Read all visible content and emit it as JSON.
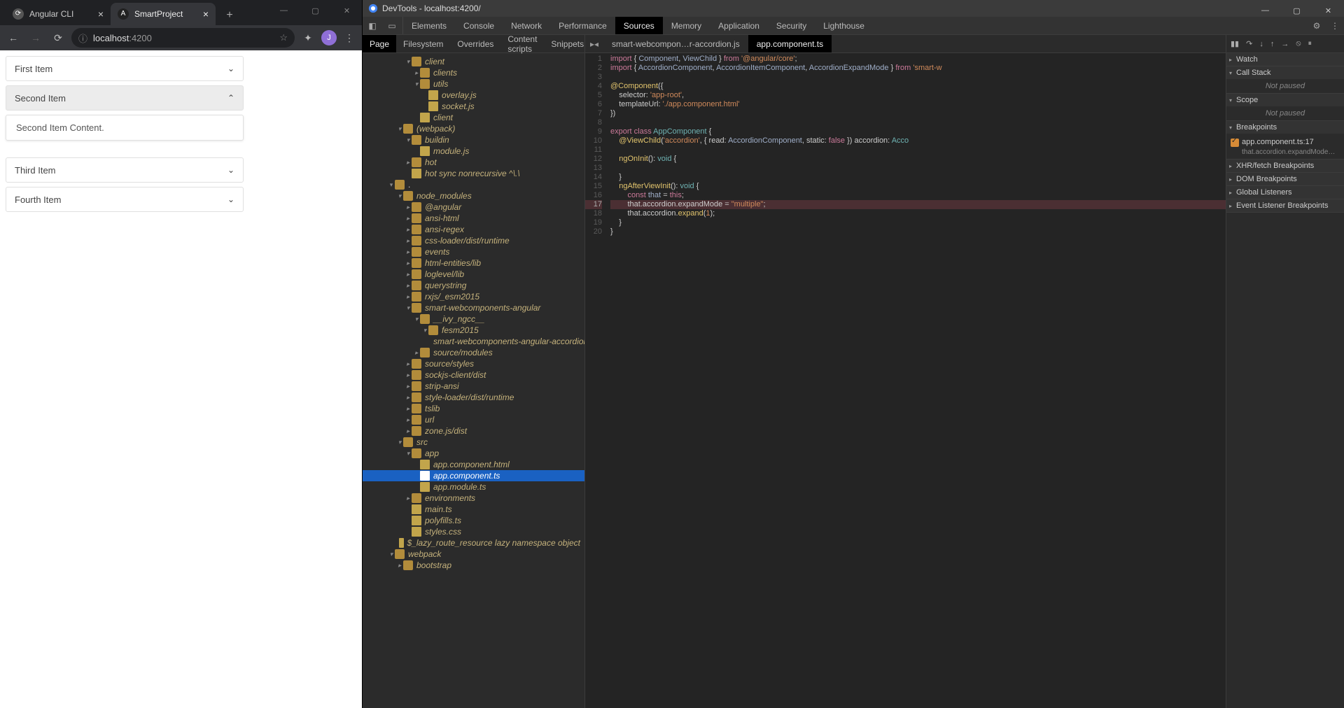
{
  "chrome": {
    "tabs": [
      {
        "label": "Angular CLI",
        "favicon": ""
      },
      {
        "label": "SmartProject",
        "favicon": "A"
      }
    ],
    "active_tab": 1,
    "url_prefix": "localhost",
    "url_suffix": ":4200",
    "avatar_letter": "J"
  },
  "accordion": [
    {
      "title": "First Item",
      "expanded": false,
      "content": ""
    },
    {
      "title": "Second Item",
      "expanded": true,
      "content": "Second Item Content."
    },
    {
      "title": "Third Item",
      "expanded": false,
      "content": ""
    },
    {
      "title": "Fourth Item",
      "expanded": false,
      "content": ""
    }
  ],
  "devtools": {
    "title": "DevTools - localhost:4200/",
    "main_tabs": [
      "Elements",
      "Console",
      "Network",
      "Performance",
      "Sources",
      "Memory",
      "Application",
      "Security",
      "Lighthouse"
    ],
    "active_main_tab": "Sources",
    "src_sub_tabs": [
      "Page",
      "Filesystem",
      "Overrides",
      "Content scripts",
      "Snippets"
    ],
    "active_src_sub": "Page",
    "editor_tabs": [
      "smart-webcompon…r-accordion.js",
      "app.component.ts"
    ],
    "active_editor_tab": 1,
    "tree": [
      {
        "d": 5,
        "a": "▾",
        "i": "folder-open",
        "t": "client",
        "it": true
      },
      {
        "d": 6,
        "a": "▸",
        "i": "folder",
        "t": "clients",
        "it": true
      },
      {
        "d": 6,
        "a": "▾",
        "i": "folder-open",
        "t": "utils",
        "it": true
      },
      {
        "d": 7,
        "a": "",
        "i": "file",
        "t": "overlay.js",
        "it": true
      },
      {
        "d": 7,
        "a": "",
        "i": "file",
        "t": "socket.js",
        "it": true
      },
      {
        "d": 6,
        "a": "",
        "i": "file",
        "t": "client",
        "it": true
      },
      {
        "d": 4,
        "a": "▾",
        "i": "folder-open",
        "t": "(webpack)",
        "it": true
      },
      {
        "d": 5,
        "a": "▾",
        "i": "folder-open",
        "t": "buildin",
        "it": true
      },
      {
        "d": 6,
        "a": "",
        "i": "file",
        "t": "module.js",
        "it": true
      },
      {
        "d": 5,
        "a": "▸",
        "i": "folder",
        "t": "hot",
        "it": true
      },
      {
        "d": 5,
        "a": "",
        "i": "file",
        "t": "hot sync nonrecursive ^\\.\\",
        "it": true
      },
      {
        "d": 3,
        "a": "▾",
        "i": "folder-open",
        "t": ".",
        "it": true,
        "plain": true
      },
      {
        "d": 4,
        "a": "▾",
        "i": "folder-open",
        "t": "node_modules",
        "it": true
      },
      {
        "d": 5,
        "a": "▸",
        "i": "folder",
        "t": "@angular",
        "it": true
      },
      {
        "d": 5,
        "a": "▸",
        "i": "folder",
        "t": "ansi-html",
        "it": true
      },
      {
        "d": 5,
        "a": "▸",
        "i": "folder",
        "t": "ansi-regex",
        "it": true
      },
      {
        "d": 5,
        "a": "▸",
        "i": "folder",
        "t": "css-loader/dist/runtime",
        "it": true
      },
      {
        "d": 5,
        "a": "▸",
        "i": "folder",
        "t": "events",
        "it": true
      },
      {
        "d": 5,
        "a": "▸",
        "i": "folder",
        "t": "html-entities/lib",
        "it": true
      },
      {
        "d": 5,
        "a": "▸",
        "i": "folder",
        "t": "loglevel/lib",
        "it": true
      },
      {
        "d": 5,
        "a": "▸",
        "i": "folder",
        "t": "querystring",
        "it": true
      },
      {
        "d": 5,
        "a": "▸",
        "i": "folder",
        "t": "rxjs/_esm2015",
        "it": true
      },
      {
        "d": 5,
        "a": "▾",
        "i": "folder-open",
        "t": "smart-webcomponents-angular",
        "it": true
      },
      {
        "d": 6,
        "a": "▾",
        "i": "folder-open",
        "t": "__ivy_ngcc__",
        "it": true
      },
      {
        "d": 7,
        "a": "▾",
        "i": "folder-open",
        "t": "fesm2015",
        "it": true
      },
      {
        "d": 8,
        "a": "",
        "i": "file",
        "t": "smart-webcomponents-angular-accordion.js",
        "it": true
      },
      {
        "d": 6,
        "a": "▸",
        "i": "folder",
        "t": "source/modules",
        "it": true
      },
      {
        "d": 5,
        "a": "▸",
        "i": "folder",
        "t": "source/styles",
        "it": true
      },
      {
        "d": 5,
        "a": "▸",
        "i": "folder",
        "t": "sockjs-client/dist",
        "it": true
      },
      {
        "d": 5,
        "a": "▸",
        "i": "folder",
        "t": "strip-ansi",
        "it": true
      },
      {
        "d": 5,
        "a": "▸",
        "i": "folder",
        "t": "style-loader/dist/runtime",
        "it": true
      },
      {
        "d": 5,
        "a": "▸",
        "i": "folder",
        "t": "tslib",
        "it": true
      },
      {
        "d": 5,
        "a": "▸",
        "i": "folder",
        "t": "url",
        "it": true
      },
      {
        "d": 5,
        "a": "▸",
        "i": "folder",
        "t": "zone.js/dist",
        "it": true
      },
      {
        "d": 4,
        "a": "▾",
        "i": "folder-open",
        "t": "src",
        "it": true
      },
      {
        "d": 5,
        "a": "▾",
        "i": "folder-open",
        "t": "app",
        "it": true
      },
      {
        "d": 6,
        "a": "",
        "i": "file",
        "t": "app.component.html",
        "it": true
      },
      {
        "d": 6,
        "a": "",
        "i": "file-ts",
        "t": "app.component.ts",
        "it": true,
        "sel": true
      },
      {
        "d": 6,
        "a": "",
        "i": "file",
        "t": "app.module.ts",
        "it": true
      },
      {
        "d": 5,
        "a": "▸",
        "i": "folder",
        "t": "environments",
        "it": true
      },
      {
        "d": 5,
        "a": "",
        "i": "file",
        "t": "main.ts",
        "it": true
      },
      {
        "d": 5,
        "a": "",
        "i": "file",
        "t": "polyfills.ts",
        "it": true
      },
      {
        "d": 5,
        "a": "",
        "i": "file",
        "t": "styles.css",
        "it": true
      },
      {
        "d": 4,
        "a": "",
        "i": "file",
        "t": "$_lazy_route_resource lazy namespace object",
        "it": true
      },
      {
        "d": 3,
        "a": "▾",
        "i": "folder-open",
        "t": "webpack",
        "it": true
      },
      {
        "d": 4,
        "a": "▸",
        "i": "folder",
        "t": "bootstrap",
        "it": true
      }
    ],
    "code_lines": [
      {
        "n": 1,
        "h": "<span class='kw'>import</span> { <span class='prop'>Component</span>, <span class='prop'>ViewChild</span> } <span class='kw'>from</span> <span class='str'>'@angular/core'</span>;"
      },
      {
        "n": 2,
        "h": "<span class='kw'>import</span> { <span class='prop'>AccordionComponent</span>, <span class='prop'>AccordionItemComponent</span>, <span class='prop'>AccordionExpandMode</span> } <span class='kw'>from</span> <span class='str'>'smart-w</span>"
      },
      {
        "n": 3,
        "h": ""
      },
      {
        "n": 4,
        "h": "<span class='fn'>@Component</span>({"
      },
      {
        "n": 5,
        "h": "    selector: <span class='str'>'app-root'</span>,"
      },
      {
        "n": 6,
        "h": "    templateUrl: <span class='str'>'./app.component.html'</span>"
      },
      {
        "n": 7,
        "h": "})"
      },
      {
        "n": 8,
        "h": ""
      },
      {
        "n": 9,
        "h": "<span class='kw'>export</span> <span class='kw'>class</span> <span class='type'>AppComponent</span> {"
      },
      {
        "n": 10,
        "h": "    <span class='fn'>@ViewChild</span>(<span class='str'>'accordion'</span>, { read: <span class='prop'>AccordionComponent</span>, static: <span class='kw'>false</span> }) accordion: <span class='type'>Acco</span>"
      },
      {
        "n": 11,
        "h": ""
      },
      {
        "n": 12,
        "h": "    <span class='fn'>ngOnInit</span>(): <span class='type'>void</span> {"
      },
      {
        "n": 13,
        "h": ""
      },
      {
        "n": 14,
        "h": "    }"
      },
      {
        "n": 15,
        "h": "    <span class='fn'>ngAfterViewInit</span>(): <span class='type'>void</span> {"
      },
      {
        "n": 16,
        "h": "        <span class='kw'>const</span> <span class='prop'>that</span> = <span class='kw'>this</span>;"
      },
      {
        "n": 17,
        "h": "        that.accordion.expandMode = <span class='str'>\"multiple\"</span>;",
        "bp": true
      },
      {
        "n": 18,
        "h": "        that.accordion.<span class='fn'>expand</span>(<span class='num'>1</span>);"
      },
      {
        "n": 19,
        "h": "    }"
      },
      {
        "n": 20,
        "h": "}"
      }
    ],
    "debug_sections": {
      "watch": "Watch",
      "callstack": "Call Stack",
      "callstack_body": "Not paused",
      "scope": "Scope",
      "scope_body": "Not paused",
      "breakpoints": "Breakpoints",
      "bp_label": "app.component.ts:17",
      "bp_sub": "that.accordion.expandMode…",
      "xhr": "XHR/fetch Breakpoints",
      "dom": "DOM Breakpoints",
      "global": "Global Listeners",
      "event": "Event Listener Breakpoints"
    }
  }
}
